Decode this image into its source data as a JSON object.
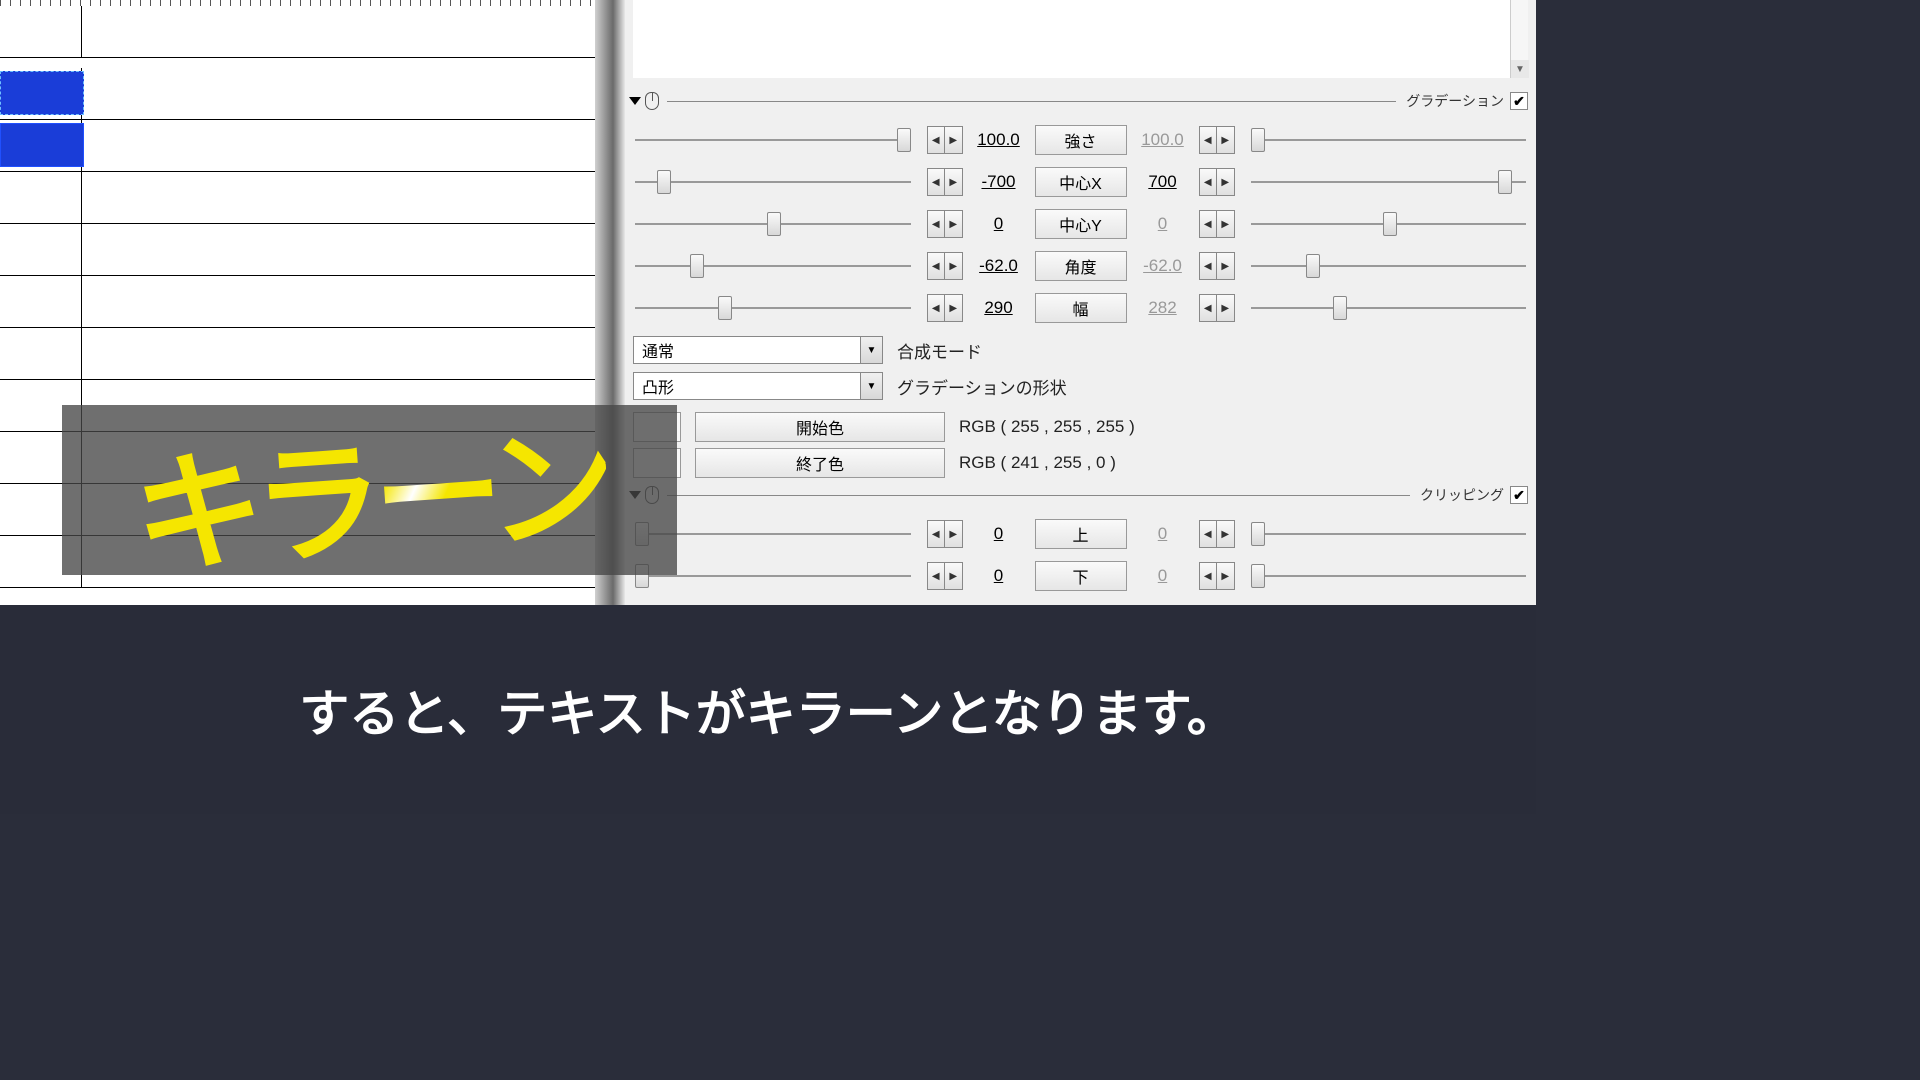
{
  "overlay_text": "キラーン",
  "caption": "すると、テキストがキラーンとなります。",
  "gradation": {
    "title": "グラデーション",
    "checked": "✔",
    "params": [
      {
        "name": "強さ",
        "l": "100.0",
        "r": "100.0",
        "rdim": true,
        "lpos": 95,
        "rpos": 0
      },
      {
        "name": "中心X",
        "l": "-700",
        "r": "700",
        "rdim": false,
        "lpos": 8,
        "rpos": 90
      },
      {
        "name": "中心Y",
        "l": "0",
        "r": "0",
        "rdim": true,
        "lpos": 48,
        "rpos": 48
      },
      {
        "name": "角度",
        "l": "-62.0",
        "r": "-62.0",
        "rdim": true,
        "lpos": 20,
        "rpos": 20
      },
      {
        "name": "幅",
        "l": "290",
        "r": "282",
        "rdim": true,
        "lpos": 30,
        "rpos": 30
      }
    ],
    "blend_mode": {
      "value": "通常",
      "label": "合成モード"
    },
    "shape": {
      "value": "凸形",
      "label": "グラデーションの形状"
    },
    "start_color": {
      "label": "開始色",
      "value": "RGB ( 255 , 255 , 255 )"
    },
    "end_color": {
      "label": "終了色",
      "value": "RGB ( 241 , 255 , 0 )"
    }
  },
  "clipping": {
    "title": "クリッピング",
    "checked": "✔",
    "params": [
      {
        "name": "上",
        "l": "0",
        "r": "0",
        "rdim": true,
        "lpos": 0,
        "rpos": 0
      },
      {
        "name": "下",
        "l": "0",
        "r": "0",
        "rdim": true,
        "lpos": 0,
        "rpos": 0
      }
    ]
  }
}
